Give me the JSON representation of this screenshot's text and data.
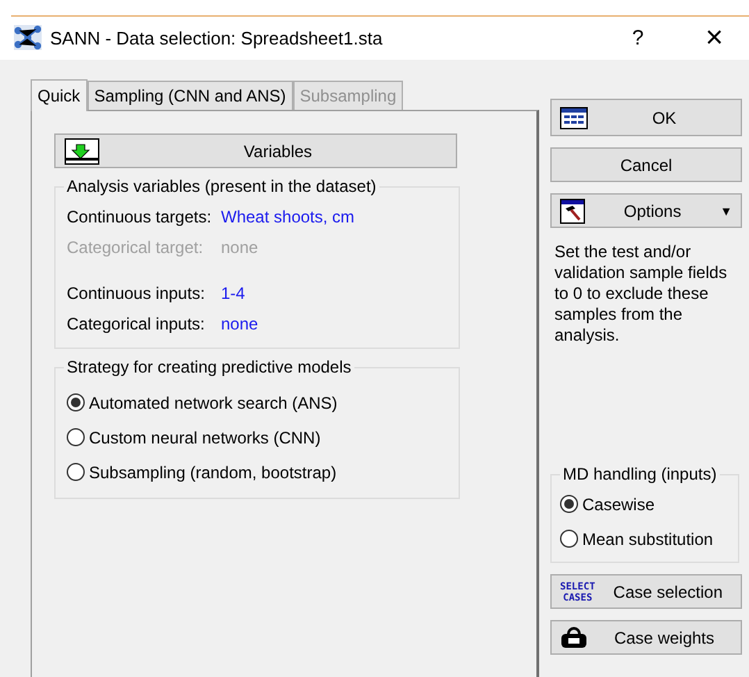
{
  "window": {
    "title": "SANN - Data selection: Spreadsheet1.sta",
    "help": "?",
    "close": "×"
  },
  "tabs": [
    {
      "label": "Quick",
      "selected": true,
      "disabled": false
    },
    {
      "label": "Sampling (CNN and ANS)",
      "selected": false,
      "disabled": false
    },
    {
      "label": "Subsampling",
      "selected": false,
      "disabled": true
    }
  ],
  "variables_button": "Variables",
  "analysis_variables": {
    "title": "Analysis variables (present in the dataset)",
    "target_rows": [
      {
        "label": "Continuous targets:",
        "value": "Wheat shoots, cm",
        "disabled": false
      },
      {
        "label": "Categorical target:",
        "value": "none",
        "disabled": true
      }
    ],
    "input_rows": [
      {
        "label": "Continuous inputs:",
        "value": "1-4",
        "disabled": false
      },
      {
        "label": "Categorical inputs:",
        "value": "none",
        "disabled": false
      }
    ]
  },
  "strategy": {
    "title": "Strategy for creating predictive models",
    "options": [
      {
        "label": "Automated network search (ANS)",
        "selected": true
      },
      {
        "label": "Custom neural networks (CNN)",
        "selected": false
      },
      {
        "label": "Subsampling (random, bootstrap)",
        "selected": false
      }
    ]
  },
  "buttons": [
    {
      "kind": "ok",
      "label": "OK"
    },
    {
      "kind": "plain",
      "label": "Cancel"
    },
    {
      "kind": "options",
      "label": "Options",
      "caret": "▼"
    }
  ],
  "hint": "Set the test and/or validation sample fields to 0 to exclude these samples from the analysis.",
  "md_handling": {
    "title": "MD handling (inputs)",
    "options": [
      {
        "label": "Casewise",
        "selected": true
      },
      {
        "label": "Mean substitution",
        "selected": false
      }
    ]
  },
  "case_buttons": [
    {
      "kind": "select",
      "label": "Case selection",
      "icon_text": [
        "SELECT",
        "CASES"
      ]
    },
    {
      "kind": "weights",
      "label": "Case weights"
    }
  ]
}
